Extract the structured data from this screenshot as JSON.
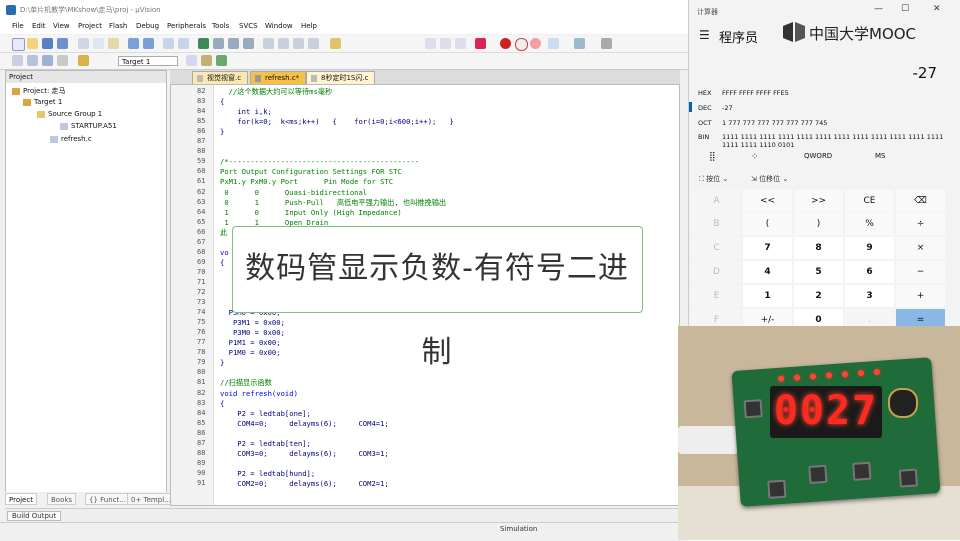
{
  "ide": {
    "title": "D:\\单片机教学\\MKshow\\走马\\proj - µVision",
    "menus": [
      "File",
      "Edit",
      "View",
      "Project",
      "Flash",
      "Debug",
      "Peripherals",
      "Tools",
      "SVCS",
      "Window",
      "Help"
    ],
    "target": "Target 1",
    "project_panel": {
      "header": "Project",
      "tree": [
        "Project: 走马",
        "Target 1",
        "Source Group 1",
        "STARTUP.A51",
        "refresh.c"
      ],
      "tabs": [
        "Project",
        "Books",
        "{} Funct...",
        "0+ Templ..."
      ]
    },
    "editor_tabs": [
      "视觉视窗.c",
      "refresh.c*",
      "8秒定时1S闪.c"
    ],
    "build_output": "Build Output",
    "status": "Simulation"
  },
  "code_lines": [
    {
      "n": "82",
      "t": "  //这个数据大约可以等待ms毫秒",
      "cls": "c"
    },
    {
      "n": "83",
      "t": "{",
      "cls": ""
    },
    {
      "n": "84",
      "t": "    int i,k;",
      "cls": ""
    },
    {
      "n": "85",
      "t": "    for(k=0;  k<ms;k++)   {    for(i=0;i<600;i++);   }",
      "cls": ""
    },
    {
      "n": "86",
      "t": "}",
      "cls": ""
    },
    {
      "n": "87",
      "t": "",
      "cls": ""
    },
    {
      "n": "88",
      "t": "",
      "cls": ""
    },
    {
      "n": "59",
      "t": "/*--------------------------------------------",
      "cls": "c"
    },
    {
      "n": "60",
      "t": "Port Output Configuration Settings FOR STC",
      "cls": "c"
    },
    {
      "n": "61",
      "t": "PxM1.y PxM0.y Port      Pin Mode for STC",
      "cls": "c"
    },
    {
      "n": "62",
      "t": " 0      0      Quasi-bidirectional",
      "cls": "c"
    },
    {
      "n": "63",
      "t": " 0      1      Push-Pull   高低电平强力输出, 也叫推挽输出",
      "cls": "c"
    },
    {
      "n": "64",
      "t": " 1      0      Input Only (High Impedance)",
      "cls": "c"
    },
    {
      "n": "65",
      "t": " 1      1      Open Drain",
      "cls": "c"
    },
    {
      "n": "66",
      "t": "此",
      "cls": "c"
    },
    {
      "n": "67",
      "t": "",
      "cls": ""
    },
    {
      "n": "68",
      "t": "vo",
      "cls": "k"
    },
    {
      "n": "69",
      "t": "{",
      "cls": ""
    },
    {
      "n": "70",
      "t": "",
      "cls": ""
    },
    {
      "n": "71",
      "t": "",
      "cls": ""
    },
    {
      "n": "72",
      "t": "",
      "cls": ""
    },
    {
      "n": "73",
      "t": "",
      "cls": ""
    },
    {
      "n": "74",
      "t": "  P5M0 = 0x00;",
      "cls": ""
    },
    {
      "n": "75",
      "t": "   P3M1 = 0x00;",
      "cls": ""
    },
    {
      "n": "76",
      "t": "   P3M0 = 0x00;",
      "cls": ""
    },
    {
      "n": "77",
      "t": "  P1M1 = 0x00;",
      "cls": ""
    },
    {
      "n": "78",
      "t": "  P1M0 = 0x00;",
      "cls": ""
    },
    {
      "n": "79",
      "t": "}",
      "cls": ""
    },
    {
      "n": "80",
      "t": "",
      "cls": ""
    },
    {
      "n": "81",
      "t": "//扫描显示函数",
      "cls": "c"
    },
    {
      "n": "82",
      "t": "void refresh(void)",
      "cls": "k"
    },
    {
      "n": "83",
      "t": "{",
      "cls": ""
    },
    {
      "n": "84",
      "t": "    P2 = ledtab[one];",
      "cls": ""
    },
    {
      "n": "85",
      "t": "    COM4=0;     delayms(6);     COM4=1;",
      "cls": ""
    },
    {
      "n": "86",
      "t": "",
      "cls": ""
    },
    {
      "n": "87",
      "t": "    P2 = ledtab[ten];",
      "cls": ""
    },
    {
      "n": "88",
      "t": "    COM3=0;     delayms(6);     COM3=1;",
      "cls": ""
    },
    {
      "n": "89",
      "t": "",
      "cls": ""
    },
    {
      "n": "90",
      "t": "    P2 = ledtab[hund];",
      "cls": ""
    },
    {
      "n": "91",
      "t": "    COM2=0;     delayms(6);     COM2=1;",
      "cls": ""
    }
  ],
  "banner": "数码管显示负数-有符号二进制",
  "calculator": {
    "title": "计算器",
    "mode": "程序员",
    "logo_text": "中国大学MOOC",
    "display": "-27",
    "hex_label": "HEX",
    "hex_value": "FFFF FFFF FFFF FFE5",
    "dec_label": "DEC",
    "dec_value": "-27",
    "oct_label": "OCT",
    "oct_value": "1 777 777 777 777 777 777 745",
    "bin_label": "BIN",
    "bin_value": "1111 1111 1111 1111 1111 1111 1111 1111 1111 1111 1111 1111 1111 1111 1110 0101",
    "word_size": "QWORD",
    "memory": "MS",
    "bitwise": "按位",
    "shift": "位移位",
    "keys": [
      [
        "A",
        "<<",
        ">>",
        "CE",
        "⌫"
      ],
      [
        "B",
        "(",
        ")",
        "%",
        "÷"
      ],
      [
        "C",
        "7",
        "8",
        "9",
        "×"
      ],
      [
        "D",
        "4",
        "5",
        "6",
        "−"
      ],
      [
        "E",
        "1",
        "2",
        "3",
        "+"
      ],
      [
        "F",
        "+/-",
        "0",
        ".",
        "="
      ]
    ]
  },
  "video": {
    "segment_display": "0027"
  }
}
